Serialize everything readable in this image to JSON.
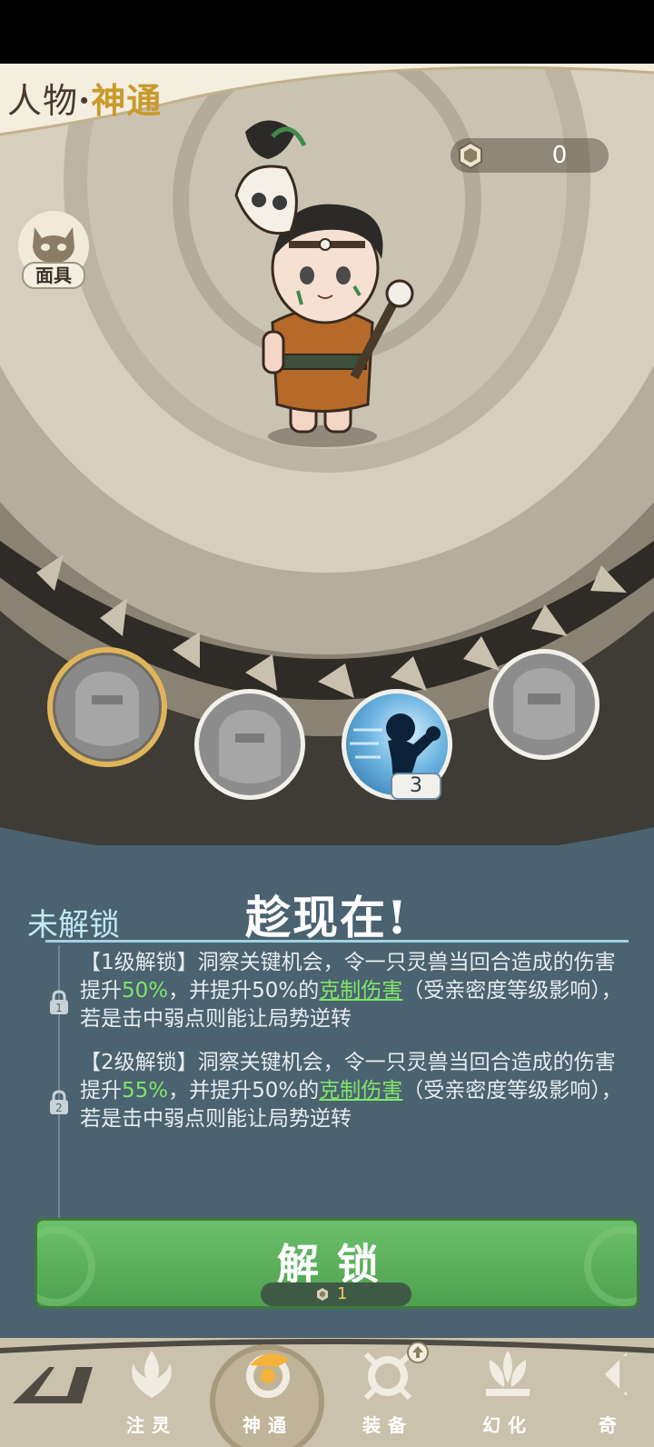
{
  "header": {
    "title_part1": "人物",
    "title_sep": "·",
    "title_part2": "神通"
  },
  "currency": {
    "icon": "medal-coin-icon",
    "value": "0"
  },
  "mask_button": {
    "label": "面具",
    "icon": "mask-icon"
  },
  "skills": [
    {
      "name": "skill-1",
      "state": "selected-locked"
    },
    {
      "name": "skill-2",
      "state": "locked"
    },
    {
      "name": "skill-3",
      "state": "unlocked",
      "level": "3"
    },
    {
      "name": "skill-4",
      "state": "locked"
    }
  ],
  "detail": {
    "status": "未解锁",
    "skill_name": "趁现在!",
    "levels": [
      {
        "lock_num": "1",
        "prefix": "【1级解锁】洞察关键机会，令一只灵兽当回合造成的伤害提升",
        "value": "50%",
        "mid": "，并提升50%的",
        "link": "克制伤害",
        "suffix": "（受亲密度等级影响），若是击中弱点则能让局势逆转"
      },
      {
        "lock_num": "2",
        "prefix": "【2级解锁】洞察关键机会，令一只灵兽当回合造成的伤害提升",
        "value": "55%",
        "mid": "，并提升50%的",
        "link": "克制伤害",
        "suffix": "（受亲密度等级影响），若是击中弱点则能让局势逆转"
      }
    ]
  },
  "unlock_button": {
    "label": "解锁",
    "cost": "1",
    "cost_icon": "medal-coin-icon"
  },
  "nav": [
    {
      "label": "",
      "icon": "logo-icon"
    },
    {
      "label": "注灵",
      "icon": "flame-icon"
    },
    {
      "label": "神通",
      "icon": "swirl-icon",
      "active": true
    },
    {
      "label": "装备",
      "icon": "ring-icon"
    },
    {
      "label": "幻化",
      "icon": "lotus-icon"
    },
    {
      "label": "奇",
      "icon": "scroll-icon"
    }
  ],
  "colors": {
    "gold": "#c99a2c",
    "highlight": "#7fe66a",
    "button_green": "#5cb05b",
    "panel": "#4b6270"
  }
}
